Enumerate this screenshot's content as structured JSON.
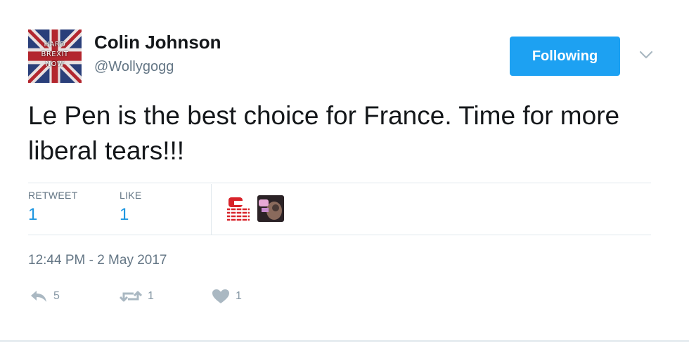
{
  "author": {
    "name": "Colin Johnson",
    "handle": "@Wollygogg",
    "avatar_icon": "union-jack-hard-brexit-avatar",
    "avatar_text": [
      "HARD",
      "BREXIT",
      "NOW"
    ]
  },
  "follow_button": {
    "label": "Following",
    "color": "#1da1f2"
  },
  "menu_icon": "chevron-down-icon",
  "tweet": {
    "text": "Le Pen is the best choice for France. Time for more liberal tears!!!"
  },
  "stats": {
    "retweet_label": "RETWEET",
    "retweet_count": "1",
    "like_label": "LIKE",
    "like_count": "1"
  },
  "liker_avatars": [
    "red-logo-avatar",
    "photo-avatar"
  ],
  "timestamp": "12:44 PM - 2 May 2017",
  "actions": {
    "reply_icon": "reply-icon",
    "reply_count": "5",
    "retweet_icon": "retweet-icon",
    "retweet_count": "1",
    "like_icon": "heart-icon",
    "like_count": "1"
  },
  "colors": {
    "accent": "#1da1f2",
    "count_blue": "#1b95e0",
    "muted": "#657786",
    "icon_gray": "#aab8c2"
  }
}
